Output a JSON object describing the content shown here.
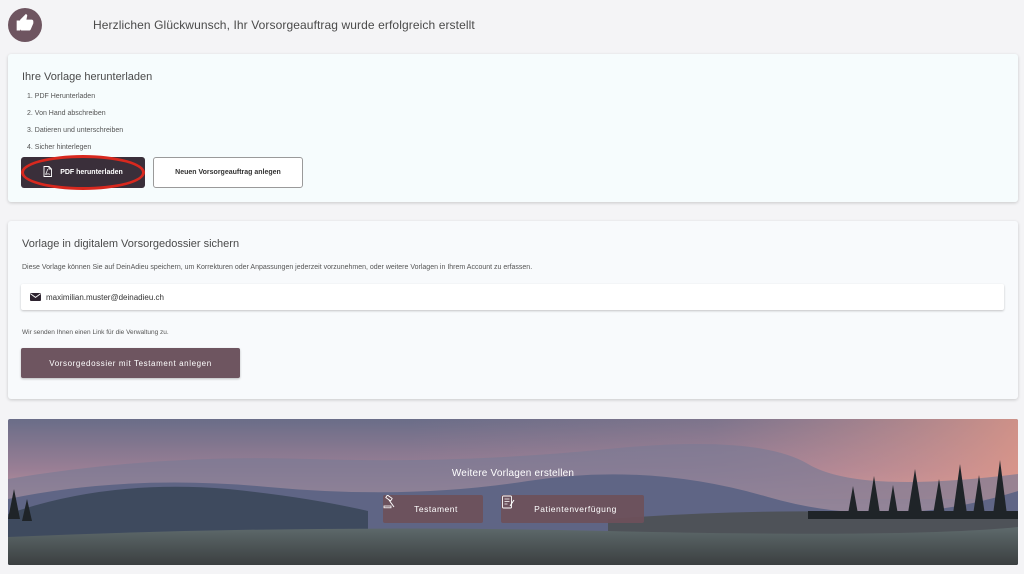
{
  "header": {
    "title": "Herzlichen Glückwunsch, Ihr Vorsorgeauftrag wurde erfolgreich erstellt",
    "avatar_icon": "thumbs-up-icon"
  },
  "download": {
    "title": "Ihre Vorlage herunterladen",
    "steps": [
      "1. PDF Herunterladen",
      "2. Von Hand abschreiben",
      "3. Datieren und unterschreiben",
      "4. Sicher hinterlegen"
    ],
    "pdf_button": "PDF herunterladen",
    "new_button": "Neuen Vorsorgeauftrag anlegen"
  },
  "dossier": {
    "title": "Vorlage in digitalem Vorsorgedossier sichern",
    "description": "Diese Vorlage können Sie auf DeinAdieu speichern, um Korrekturen oder Anpassungen jederzeit vorzunehmen, oder weitere Vorlagen in Ihrem Account zu erfassen.",
    "email": "maximilian.muster@deinadieu.ch",
    "note": "Wir senden Ihnen einen Link für die Verwaltung zu.",
    "create_button": "Vorsorgedossier mit Testament anlegen"
  },
  "banner": {
    "title": "Weitere Vorlagen erstellen",
    "testament_button": "Testament",
    "patient_button": "Patientenverfügung"
  },
  "colors": {
    "accent": "#6e5560",
    "dark_button": "#3a2f3a",
    "highlight_ring": "#d8281e"
  }
}
